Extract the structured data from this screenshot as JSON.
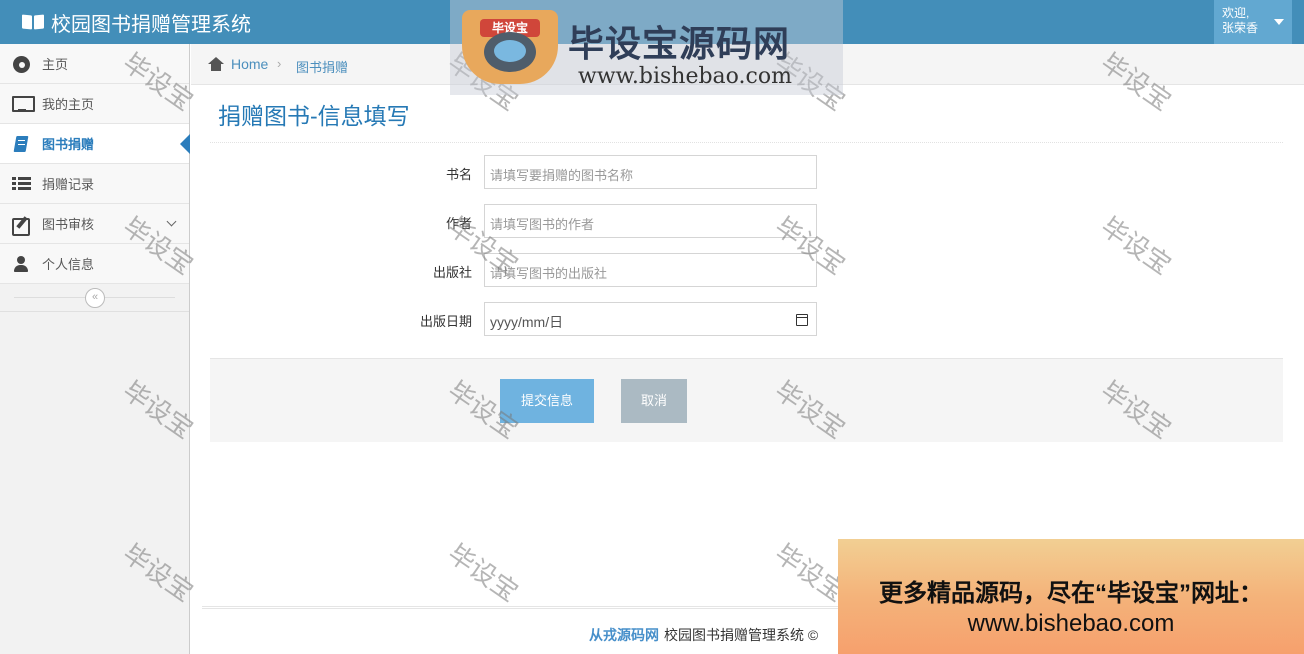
{
  "app": {
    "title": "校园图书捐赠管理系统"
  },
  "user_menu": {
    "greeting": "欢迎,",
    "name": "张荣香"
  },
  "sidebar": {
    "items": [
      {
        "label": "主页",
        "icon": "dashboard-icon"
      },
      {
        "label": "我的主页",
        "icon": "desktop-icon"
      },
      {
        "label": "图书捐赠",
        "icon": "book-icon",
        "active": true
      },
      {
        "label": "捐赠记录",
        "icon": "list-icon"
      },
      {
        "label": "图书审核",
        "icon": "edit-icon",
        "has_submenu": true
      },
      {
        "label": "个人信息",
        "icon": "user-icon"
      }
    ],
    "collapse_symbol": "«"
  },
  "breadcrumb": {
    "home": "Home",
    "separator": "›",
    "current": "图书捐赠"
  },
  "page": {
    "title": "捐赠图书-信息填写"
  },
  "form": {
    "book_name": {
      "label": "书名",
      "placeholder": "请填写要捐赠的图书名称"
    },
    "author": {
      "label": "作者",
      "placeholder": "请填写图书的作者"
    },
    "publisher": {
      "label": "出版社",
      "placeholder": "请填写图书的出版社"
    },
    "publish_date": {
      "label": "出版日期",
      "placeholder": "yyyy/mm/日"
    },
    "submit_label": "提交信息",
    "cancel_label": "取消"
  },
  "footer": {
    "brand": "从戎源码网",
    "text": "校园图书捐赠管理系统 ©"
  },
  "watermark": {
    "text": "毕设宝"
  },
  "banner": {
    "logo_label": "毕设宝",
    "title": "毕设宝源码网",
    "url": "www.bishebao.com"
  },
  "ad": {
    "line1": "更多精品源码，尽在“毕设宝”网址：",
    "line2": "www.bishebao.com"
  },
  "colors": {
    "navbar": "#438eb9",
    "accent": "#2679b5",
    "submit": "#6fb3e0",
    "cancel": "#abbac3"
  }
}
